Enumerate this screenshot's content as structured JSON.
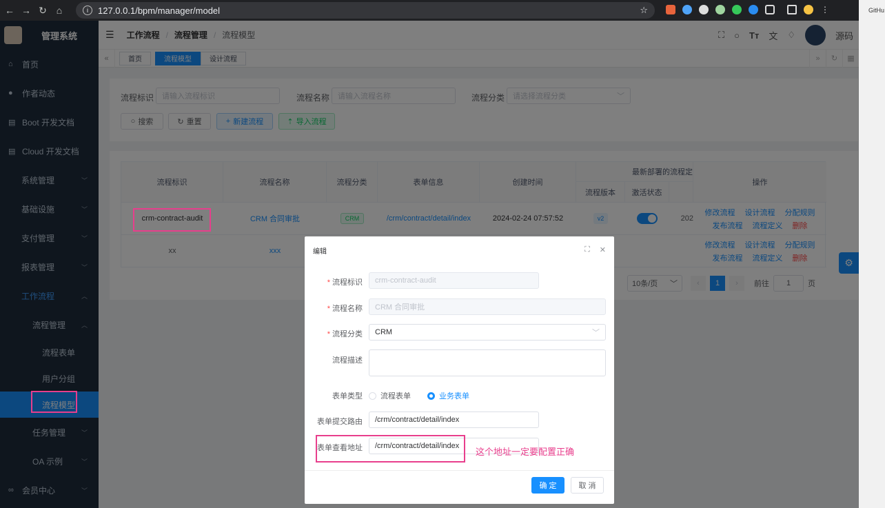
{
  "browser": {
    "url": "127.0.0.1/bpm/manager/model",
    "right_strip_text": "GitHu"
  },
  "sidebar": {
    "app_title": "管理系统",
    "items": [
      {
        "label": "首页",
        "icon": "home-icon"
      },
      {
        "label": "作者动态",
        "icon": "user-icon"
      },
      {
        "label": "Boot 开发文档",
        "icon": "doc-icon"
      },
      {
        "label": "Cloud 开发文档",
        "icon": "doc-icon"
      },
      {
        "label": "系统管理"
      },
      {
        "label": "基础设施"
      },
      {
        "label": "支付管理"
      },
      {
        "label": "报表管理"
      },
      {
        "label": "工作流程"
      },
      {
        "label": "流程管理"
      },
      {
        "label": "流程表单"
      },
      {
        "label": "用户分组"
      },
      {
        "label": "流程模型"
      },
      {
        "label": "任务管理"
      },
      {
        "label": "OA 示例"
      },
      {
        "label": "会员中心",
        "icon": "member-icon"
      }
    ]
  },
  "navbar": {
    "crumbs": [
      "工作流程",
      "流程管理",
      "流程模型"
    ],
    "right_text": "源码"
  },
  "tags": [
    "首页",
    "流程模型",
    "设计流程"
  ],
  "search": {
    "key_label": "流程标识",
    "key_placeholder": "请输入流程标识",
    "name_label": "流程名称",
    "name_placeholder": "请输入流程名称",
    "cat_label": "流程分类",
    "cat_placeholder": "请选择流程分类",
    "btn_search": "搜索",
    "btn_reset": "重置",
    "btn_new": "新建流程",
    "btn_import": "导入流程"
  },
  "table": {
    "headers": [
      "流程标识",
      "流程名称",
      "流程分类",
      "表单信息",
      "创建时间",
      "最新部署的流程定",
      "流程版本",
      "激活状态",
      "操作"
    ],
    "rows": [
      {
        "key": "crm-contract-audit",
        "name": "CRM 合同审批",
        "category": "CRM",
        "form": "/crm/contract/detail/index",
        "created": "2024-02-24 07:57:52",
        "version": "v2",
        "active": true,
        "deploy_time": "202"
      },
      {
        "key": "xx",
        "name": "xxx"
      }
    ],
    "ops_line1": [
      "修改流程",
      "设计流程",
      "分配规则"
    ],
    "ops_line2": [
      "发布流程",
      "流程定义",
      "删除"
    ]
  },
  "pager": {
    "size": "10条/页",
    "page": "1",
    "goto_label": "前往",
    "goto_value": "1",
    "page_suffix": "页"
  },
  "dialog": {
    "title": "编辑",
    "fields": {
      "key_label": "流程标识",
      "key_value": "crm-contract-audit",
      "name_label": "流程名称",
      "name_value": "CRM 合同审批",
      "cat_label": "流程分类",
      "cat_value": "CRM",
      "desc_label": "流程描述",
      "type_label": "表单类型",
      "type_opt1": "流程表单",
      "type_opt2": "业务表单",
      "submit_label": "表单提交路由",
      "submit_value": "/crm/contract/detail/index",
      "view_label": "表单查看地址",
      "view_value": "/crm/contract/detail/index"
    },
    "ok": "确 定",
    "cancel": "取 消"
  },
  "annotation": "这个地址一定要配置正确",
  "colors": {
    "primary": "#1890ff",
    "highlight": "#e83e8c",
    "sidebar": "#1f2d3d"
  }
}
